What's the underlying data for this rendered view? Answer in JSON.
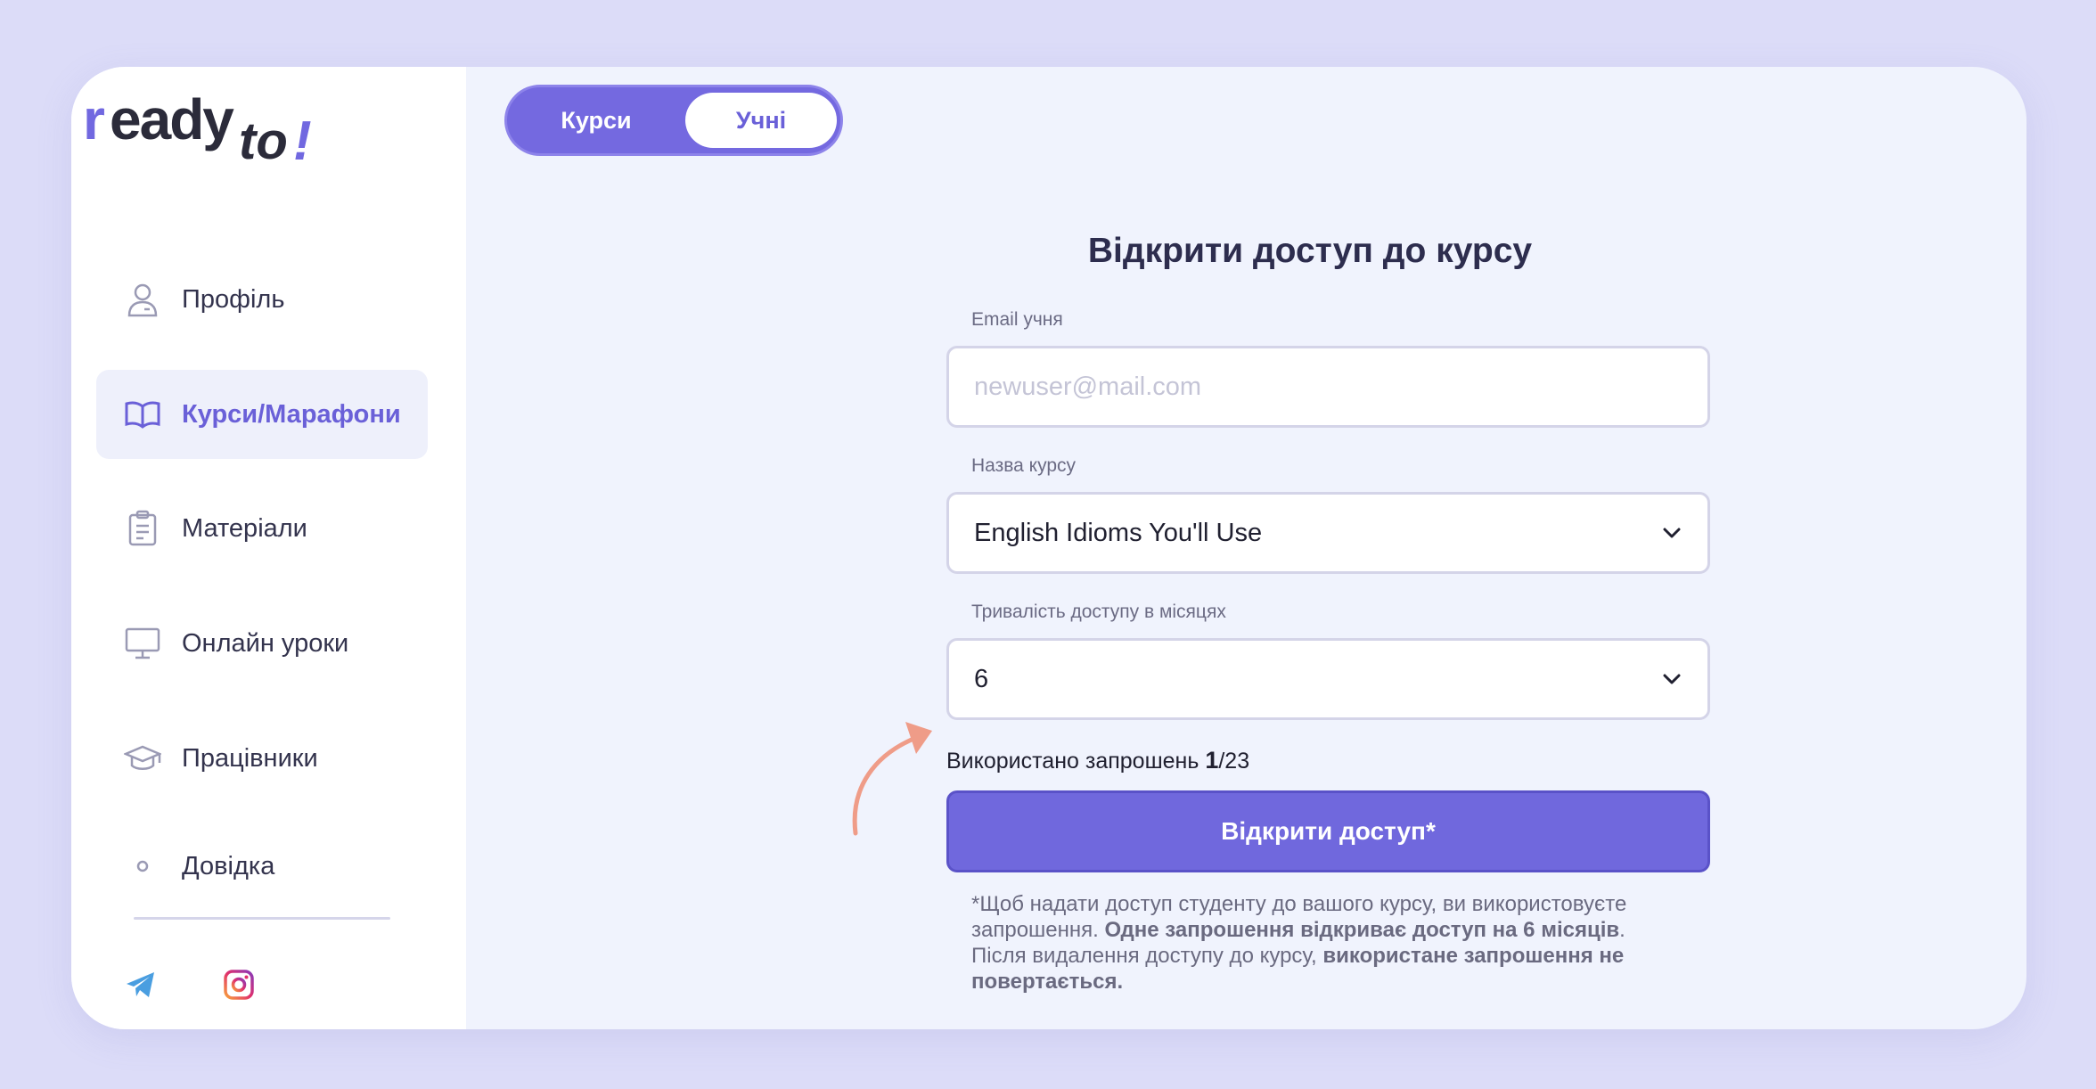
{
  "brand": {
    "logo_r": "r",
    "logo_main": "eady",
    "logo_to": "to",
    "logo_excl": "!"
  },
  "sidebar": {
    "items": [
      {
        "label": "Профіль",
        "icon": "user-icon",
        "active": false
      },
      {
        "label": "Курси/Марафони",
        "icon": "book-icon",
        "active": true
      },
      {
        "label": "Матеріали",
        "icon": "clipboard-icon",
        "active": false
      },
      {
        "label": "Онлайн уроки",
        "icon": "monitor-icon",
        "active": false
      },
      {
        "label": "Працівники",
        "icon": "graduation-cap-icon",
        "active": false
      },
      {
        "label": "Довідка",
        "icon": "dot-icon",
        "active": false
      }
    ],
    "social": [
      "telegram-icon",
      "instagram-icon"
    ]
  },
  "tabs": {
    "courses": "Курси",
    "students": "Учні"
  },
  "form": {
    "title": "Відкрити доступ до курсу",
    "email_label": "Email учня",
    "email_placeholder": "newuser@mail.com",
    "course_label": "Назва курсу",
    "course_value": "English Idioms You'll Use",
    "duration_label": "Тривалість доступу в місяцях",
    "duration_value": "6",
    "invites_prefix": "Використано запрошень ",
    "invites_used": "1",
    "invites_total": "/23",
    "submit_label": "Відкрити доступ*",
    "note_part1": "*Щоб надати доступ студенту до вашого курсу, ви використовуєте запрошення. ",
    "note_bold1": "Одне запрошення відкриває доступ на 6 місяців",
    "note_part2": ". Після видалення доступу до курсу, ",
    "note_bold2": "використане запрошення не повертається."
  },
  "colors": {
    "accent": "#7068dd",
    "background": "#f0f3fd",
    "annotation_arrow": "#ef9c88"
  }
}
